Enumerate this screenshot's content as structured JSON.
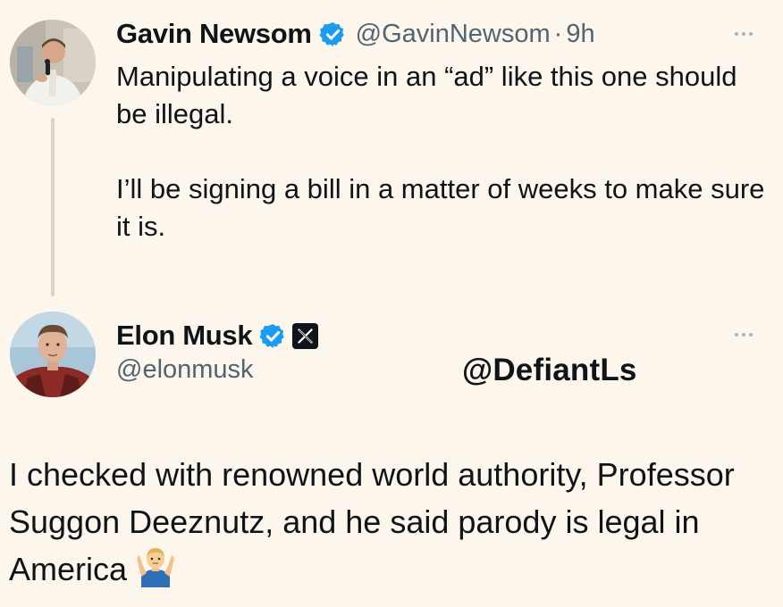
{
  "tweet": {
    "author_name": "Gavin Newsom",
    "handle": "@GavinNewsom",
    "separator": "·",
    "time": "9h",
    "paragraphs": [
      "Manipulating a voice in an “ad” like this one should be illegal.",
      "I’ll be signing a bill in a matter of weeks to make sure it is."
    ],
    "avatar_icon": "person-photo-avatar",
    "verified_icon": "verified-badge-icon",
    "menu_icon": "more-options-icon"
  },
  "reply": {
    "author_name": "Elon Musk",
    "handle": "@elonmusk",
    "text": "I checked with renowned world authority, Professor Suggon Deeznutz, and he said parody is legal in America",
    "emoji": "person-shrugging-emoji",
    "avatar_icon": "person-photo-avatar",
    "verified_icon": "verified-badge-icon",
    "affiliation_icon": "x-logo-icon",
    "menu_icon": "more-options-icon"
  },
  "watermark": "@DefiantLs",
  "colors": {
    "background": "#fcf6ec",
    "text": "#0f1419",
    "muted": "#536471",
    "verified": "#1d9bf0",
    "thread_line": "#d9d3c8"
  }
}
